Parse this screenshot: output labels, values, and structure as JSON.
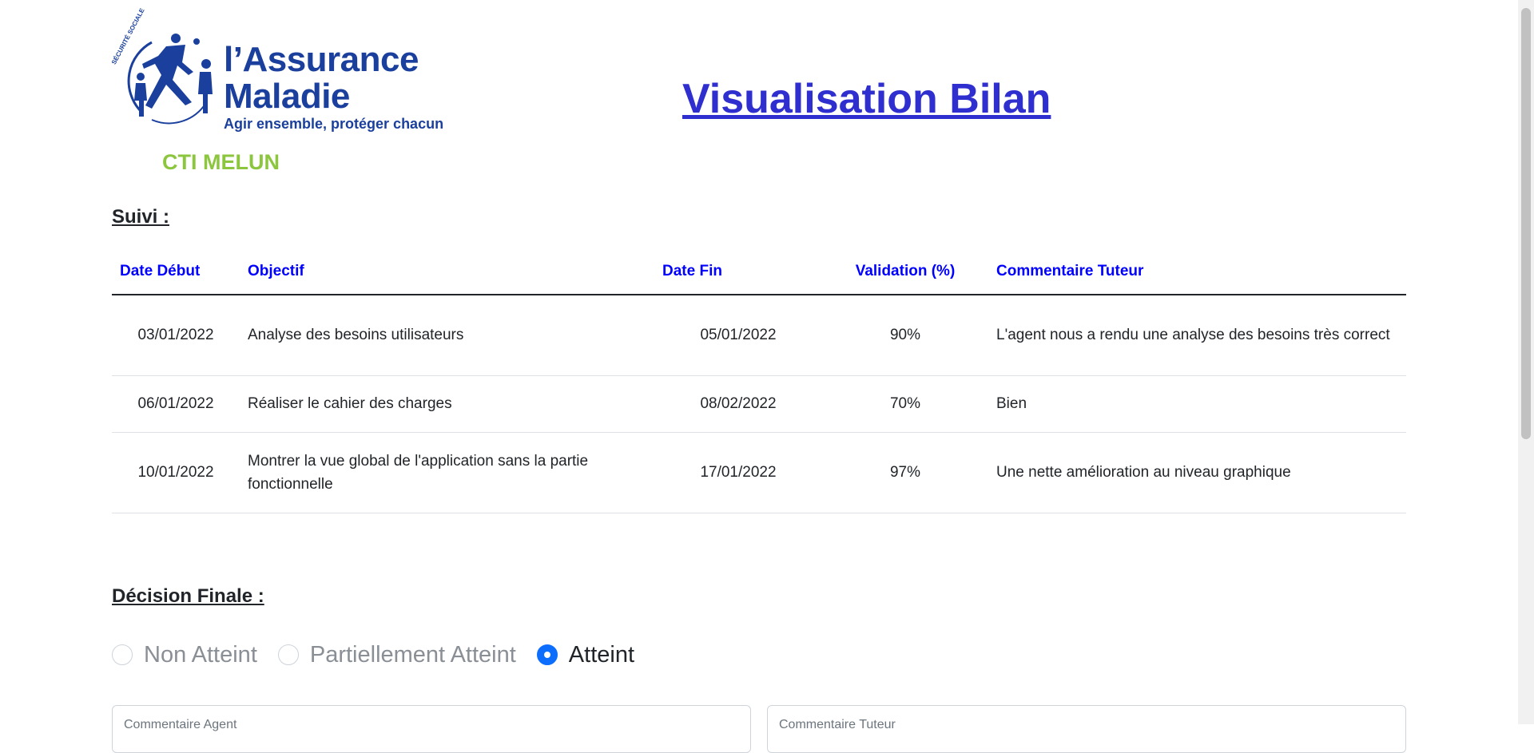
{
  "header": {
    "logo_title_line1": "l’Assurance",
    "logo_title_line2": "Maladie",
    "logo_tagline": "Agir ensemble, protéger chacun",
    "logo_arc_text": "SÉCURITÉ SOCIALE",
    "logo_subtitle": "CTI MELUN",
    "page_title": "Visualisation Bilan"
  },
  "suivi": {
    "title": "Suivi :",
    "columns": [
      "Date Début",
      "Objectif",
      "Date Fin",
      "Validation (%)",
      "Commentaire Tuteur"
    ],
    "rows": [
      {
        "date_debut": "03/01/2022",
        "objectif": "Analyse des besoins utilisateurs",
        "date_fin": "05/01/2022",
        "validation": "90%",
        "commentaire": "L'agent nous a rendu une analyse des besoins très correct"
      },
      {
        "date_debut": "06/01/2022",
        "objectif": "Réaliser le cahier des charges",
        "date_fin": "08/02/2022",
        "validation": "70%",
        "commentaire": "Bien"
      },
      {
        "date_debut": "10/01/2022",
        "objectif": "Montrer la vue global de l'application sans la partie fonctionnelle",
        "date_fin": "17/01/2022",
        "validation": "97%",
        "commentaire": "Une nette amélioration au niveau graphique"
      }
    ]
  },
  "decision": {
    "title": "Décision Finale :",
    "options": [
      "Non Atteint",
      "Partiellement Atteint",
      "Atteint"
    ],
    "selected": "Atteint",
    "agent_comment_placeholder": "Commentaire Agent",
    "tutor_comment_placeholder": "Commentaire Tuteur"
  },
  "colors": {
    "brand_blue": "#1a3f9c",
    "brand_green": "#8cc63f",
    "title_blue": "#2f2fd0",
    "header_blue": "#0000ff",
    "radio_checked": "#0d6efd"
  }
}
